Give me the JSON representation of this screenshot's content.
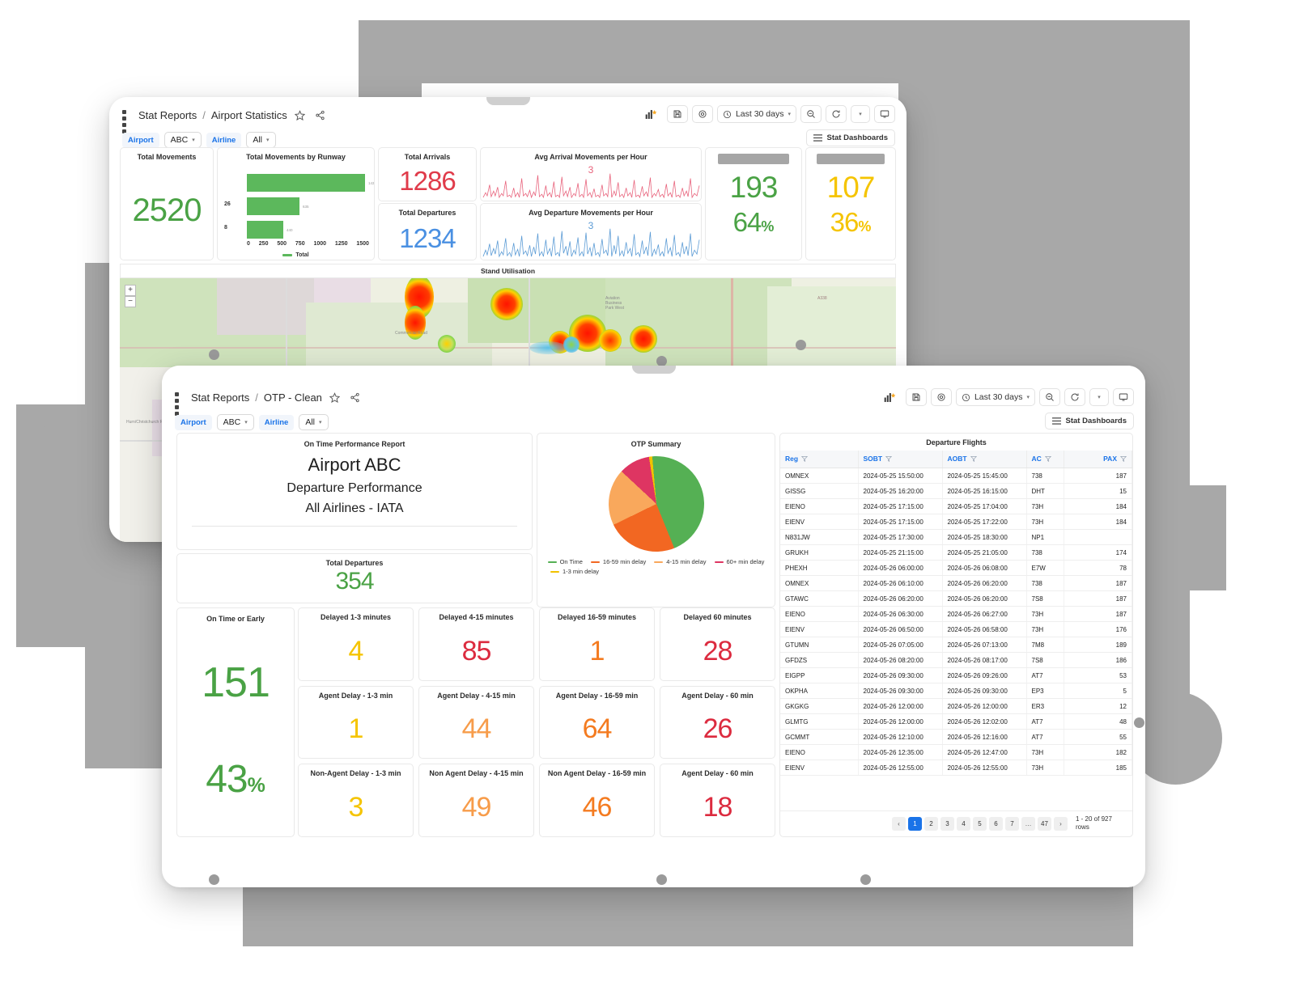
{
  "window_airport_stats": {
    "breadcrumb": {
      "root": "Stat Reports",
      "separator": "/",
      "current": "Airport Statistics"
    },
    "icons": {
      "apps": "apps-grid-icon",
      "star": "star-icon",
      "share": "share-icon"
    },
    "filters": [
      {
        "label": "Airport",
        "value": "ABC"
      },
      {
        "label": "Airline",
        "value": "All"
      }
    ],
    "toolbar": {
      "chart_btn": "chart-add-icon",
      "save_btn": "save-icon",
      "settings_btn": "settings-icon",
      "date_range": "Last 30 days",
      "zoom_out_btn": "zoom-out-icon",
      "refresh_btn": "refresh-icon",
      "refresh_caret": "chevron-down-icon",
      "display_btn": "monitor-icon"
    },
    "dashboards_button": "Stat Dashboards",
    "cards": {
      "total_movements": {
        "title": "Total Movements",
        "value": "2520"
      },
      "movements_by_runway": {
        "title": "Total Movements by Runway",
        "legend": "Total"
      },
      "total_arrivals": {
        "title": "Total Arrivals",
        "value": "1286"
      },
      "total_departures": {
        "title": "Total Departures",
        "value": "1234"
      },
      "avg_arrival": {
        "title": "Avg Arrival Movements per Hour",
        "value": "3"
      },
      "avg_departure": {
        "title": "Avg Departure Movements per Hour",
        "value": "3"
      },
      "stat_green": {
        "value": "193",
        "pct": "64",
        "pct_symbol": "%"
      },
      "stat_yellow": {
        "value": "107",
        "pct": "36",
        "pct_symbol": "%"
      }
    },
    "map_panel": {
      "title": "Stand Utilisation",
      "zoom_in": "+",
      "zoom_out": "−"
    }
  },
  "window_otp": {
    "breadcrumb": {
      "root": "Stat Reports",
      "separator": "/",
      "current": "OTP - Clean"
    },
    "filters": [
      {
        "label": "Airport",
        "value": "ABC"
      },
      {
        "label": "Airline",
        "value": "All"
      }
    ],
    "toolbar": {
      "date_range": "Last 30 days"
    },
    "dashboards_button": "Stat Dashboards",
    "report_header": {
      "subtitle": "On Time Performance Report",
      "line1": "Airport ABC",
      "line2": "Departure Performance",
      "line3": "All Airlines - IATA"
    },
    "total_departures": {
      "title": "Total Departures",
      "value": "354"
    },
    "on_time": {
      "title": "On Time or Early",
      "value": "151",
      "pct": "43",
      "pct_symbol": "%"
    },
    "metrics": [
      {
        "title": "Delayed 1-3 minutes",
        "value": "4",
        "color": "yellow"
      },
      {
        "title": "Delayed 4-15 minutes",
        "value": "85",
        "color": "crimson"
      },
      {
        "title": "Delayed 16-59 minutes",
        "value": "1",
        "color": "orange"
      },
      {
        "title": "Delayed 60 minutes",
        "value": "28",
        "color": "crimson"
      },
      {
        "title": "Agent Delay - 1-3 min",
        "value": "1",
        "color": "yellow"
      },
      {
        "title": "Agent Delay - 4-15 min",
        "value": "44",
        "color": "orange-l"
      },
      {
        "title": "Agent Delay - 16-59 min",
        "value": "64",
        "color": "orange"
      },
      {
        "title": "Agent Delay - 60 min",
        "value": "26",
        "color": "crimson"
      },
      {
        "title": "Non-Agent Delay - 1-3 min",
        "value": "3",
        "color": "yellow"
      },
      {
        "title": "Non Agent Delay - 4-15 min",
        "value": "49",
        "color": "orange-l"
      },
      {
        "title": "Non Agent Delay - 16-59 min",
        "value": "46",
        "color": "orange"
      },
      {
        "title": "Agent Delay - 60 min",
        "value": "18",
        "color": "crimson"
      }
    ],
    "flights_table": {
      "title": "Departure Flights",
      "columns": [
        "Reg",
        "SOBT",
        "AOBT",
        "AC",
        "PAX"
      ],
      "rows": [
        [
          "OMNEX",
          "2024-05-25 15:50:00",
          "2024-05-25 15:45:00",
          "738",
          "187"
        ],
        [
          "GISSG",
          "2024-05-25 16:20:00",
          "2024-05-25 16:15:00",
          "DHT",
          "15"
        ],
        [
          "EIENO",
          "2024-05-25 17:15:00",
          "2024-05-25 17:04:00",
          "73H",
          "184"
        ],
        [
          "EIENV",
          "2024-05-25 17:15:00",
          "2024-05-25 17:22:00",
          "73H",
          "184"
        ],
        [
          "N831JW",
          "2024-05-25 17:30:00",
          "2024-05-25 18:30:00",
          "NP1",
          ""
        ],
        [
          "GRUKH",
          "2024-05-25 21:15:00",
          "2024-05-25 21:05:00",
          "738",
          "174"
        ],
        [
          "PHEXH",
          "2024-05-26 06:00:00",
          "2024-05-26 06:08:00",
          "E7W",
          "78"
        ],
        [
          "OMNEX",
          "2024-05-26 06:10:00",
          "2024-05-26 06:20:00",
          "738",
          "187"
        ],
        [
          "GTAWC",
          "2024-05-26 06:20:00",
          "2024-05-26 06:20:00",
          "7S8",
          "187"
        ],
        [
          "EIENO",
          "2024-05-26 06:30:00",
          "2024-05-26 06:27:00",
          "73H",
          "187"
        ],
        [
          "EIENV",
          "2024-05-26 06:50:00",
          "2024-05-26 06:58:00",
          "73H",
          "176"
        ],
        [
          "GTUMN",
          "2024-05-26 07:05:00",
          "2024-05-26 07:13:00",
          "7M8",
          "189"
        ],
        [
          "GFDZS",
          "2024-05-26 08:20:00",
          "2024-05-26 08:17:00",
          "7S8",
          "186"
        ],
        [
          "EIGPP",
          "2024-05-26 09:30:00",
          "2024-05-26 09:26:00",
          "AT7",
          "53"
        ],
        [
          "OKPHA",
          "2024-05-26 09:30:00",
          "2024-05-26 09:30:00",
          "EP3",
          "5"
        ],
        [
          "GKGKG",
          "2024-05-26 12:00:00",
          "2024-05-26 12:00:00",
          "ER3",
          "12"
        ],
        [
          "GLMTG",
          "2024-05-26 12:00:00",
          "2024-05-26 12:02:00",
          "AT7",
          "48"
        ],
        [
          "GCMMT",
          "2024-05-26 12:10:00",
          "2024-05-26 12:16:00",
          "AT7",
          "55"
        ],
        [
          "EIENO",
          "2024-05-26 12:35:00",
          "2024-05-26 12:47:00",
          "73H",
          "182"
        ],
        [
          "EIENV",
          "2024-05-26 12:55:00",
          "2024-05-26 12:55:00",
          "73H",
          "185"
        ]
      ],
      "pagination": {
        "prev": "‹",
        "pages": [
          "1",
          "2",
          "3",
          "4",
          "5",
          "6",
          "7"
        ],
        "ellipsis": "…",
        "last": "47",
        "next": "›",
        "active": "1",
        "rows_info": "1 - 20 of 927 rows"
      }
    }
  },
  "chart_data": [
    {
      "type": "bar",
      "title": "Total Movements by Runway",
      "orientation": "horizontal",
      "categories": [
        "",
        "26",
        "8"
      ],
      "values": [
        1430,
        635,
        440
      ],
      "value_labels": [
        "1430",
        "635",
        "440"
      ],
      "xlabel": "",
      "ylabel": "",
      "xlim": [
        0,
        1500
      ],
      "xticks": [
        "0",
        "250",
        "500",
        "750",
        "1000",
        "1250",
        "1500"
      ],
      "legend": [
        "Total"
      ],
      "legend_position": "bottom",
      "series_color": "#5cb85c",
      "grid": false
    },
    {
      "type": "pie",
      "title": "OTP Summary",
      "labels": [
        "On Time",
        "16-59 min delay",
        "4-15 min delay",
        "60+ min delay",
        "1-3 min delay"
      ],
      "values": [
        44.4,
        23.9,
        19.2,
        10.6,
        1.1
      ],
      "colors": [
        "#55b054",
        "#f26722",
        "#f9a85c",
        "#de3562",
        "#f2c200"
      ],
      "legend_position": "bottom"
    },
    {
      "type": "line",
      "title": "Avg Arrival Movements per Hour",
      "annotation": "3",
      "color": "#e8637c",
      "ylabel": "",
      "xlabel": ""
    },
    {
      "type": "line",
      "title": "Avg Departure Movements per Hour",
      "annotation": "3",
      "color": "#5b9bd5",
      "ylabel": "",
      "xlabel": ""
    }
  ],
  "palette": {
    "green": "#4aa245",
    "red": "#e03b4a",
    "crimson": "#dc2b3f",
    "blue": "#4a90e2",
    "yellow": "#f5c400",
    "orange": "#f47b20",
    "orange_light": "#f79c4a",
    "accent_blue": "#1a73e8"
  }
}
